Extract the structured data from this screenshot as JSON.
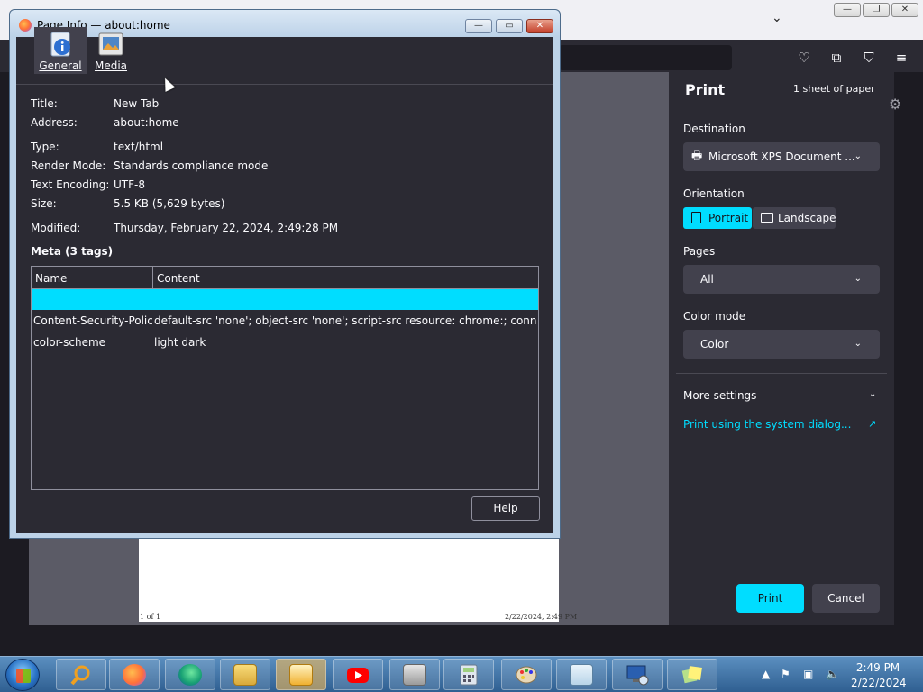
{
  "window": {
    "title": "Page Info — about:home"
  },
  "tabs": [
    {
      "label": "General"
    },
    {
      "label": "Media"
    }
  ],
  "general": {
    "title_label": "Title:",
    "title_value": "New Tab",
    "address_label": "Address:",
    "address_value": "about:home",
    "type_label": "Type:",
    "type_value": "text/html",
    "render_label": "Render Mode:",
    "render_value": "Standards compliance mode",
    "encoding_label": "Text Encoding:",
    "encoding_value": "UTF-8",
    "size_label": "Size:",
    "size_value": "5.5 KB (5,629 bytes)",
    "modified_label": "Modified:",
    "modified_value": "Thursday, February 22, 2024, 2:49:28 PM"
  },
  "meta": {
    "heading": "Meta (3 tags)",
    "columns": [
      "Name",
      "Content"
    ],
    "rows": [
      {
        "name": "",
        "content": ""
      },
      {
        "name": "Content-Security-Polic...",
        "content": "default-src 'none'; object-src 'none'; script-src resource: chrome:; connect-src ..."
      },
      {
        "name": "color-scheme",
        "content": "light dark"
      }
    ]
  },
  "dialog": {
    "help_label": "Help",
    "minimize": "—",
    "maximize": "▭",
    "close": "✕"
  },
  "print": {
    "title": "Print",
    "sheets": "1 sheet of paper",
    "destination_label": "Destination",
    "destination_value": "Microsoft XPS Document ...",
    "orientation_label": "Orientation",
    "portrait_label": "Portrait",
    "landscape_label": "Landscape",
    "pages_label": "Pages",
    "pages_value": "All",
    "color_mode_label": "Color mode",
    "color_mode_value": "Color",
    "more_settings": "More settings",
    "system_dialog": "Print using the system dialog...",
    "print_button": "Print",
    "cancel_button": "Cancel",
    "accent": "#00ddff"
  },
  "preview": {
    "page_counter": "1 of 1",
    "footer_date": "2/22/2024, 2:49 PM"
  },
  "taskbar": {
    "time": "2:49 PM",
    "date": "2/22/2024",
    "apps": [
      "search-app",
      "firefox-app",
      "edge-app",
      "explorer-app",
      "media-player-app",
      "youtube-app",
      "fax-app",
      "calculator-app",
      "paint-app",
      "notepad-app",
      "remote-desktop-app",
      "sticky-notes-app"
    ]
  }
}
